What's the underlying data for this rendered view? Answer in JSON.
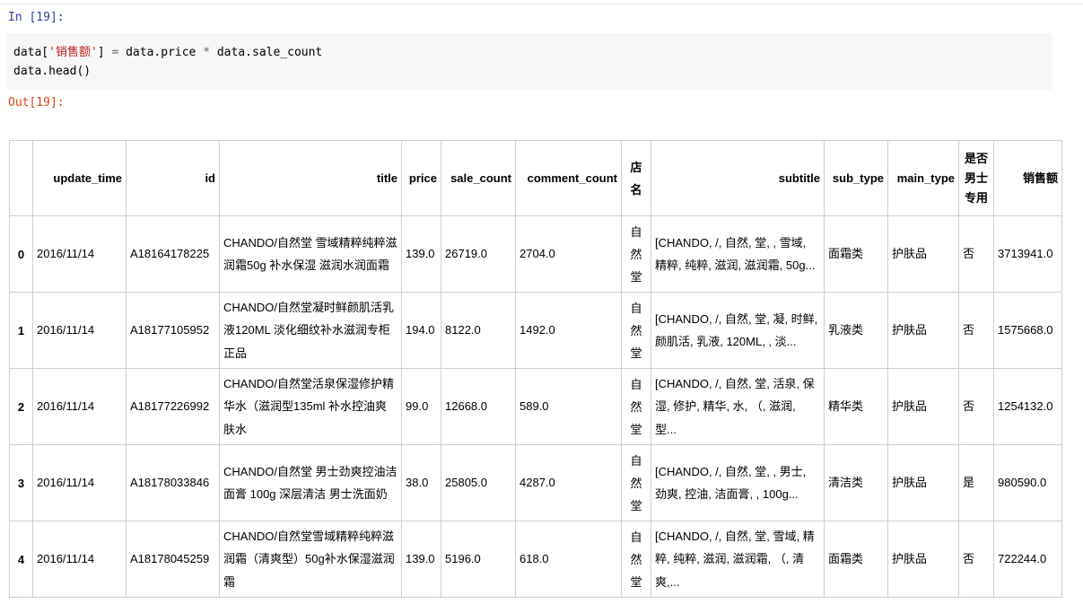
{
  "cell": {
    "in_prompt": "In [19]:",
    "code_line1": {
      "a": "data[",
      "b": "'销售额'",
      "c": "] ",
      "d": "=",
      "e": " data.price ",
      "f": "*",
      "g": " data.sale_count"
    },
    "code_line2": "data.head()",
    "out_prompt": "Out[19]:"
  },
  "table": {
    "columns": [
      "",
      "update_time",
      "id",
      "title",
      "price",
      "sale_count",
      "comment_count",
      "店名",
      "subtitle",
      "sub_type",
      "main_type",
      "是否男士专用",
      "销售额"
    ],
    "rows": [
      [
        "0",
        "2016/11/14",
        "A18164178225",
        "CHANDO/自然堂 雪域精粹纯粹滋润霜50g 补水保湿 滋润水润面霜",
        "139.0",
        "26719.0",
        "2704.0",
        "自然堂",
        "[CHANDO, /, 自然, 堂, , 雪域, 精粹, 纯粹, 滋润, 滋润霜, 50g...",
        "面霜类",
        "护肤品",
        "否",
        "3713941.0"
      ],
      [
        "1",
        "2016/11/14",
        "A18177105952",
        "CHANDO/自然堂凝时鲜颜肌活乳液120ML 淡化细纹补水滋润专柜正品",
        "194.0",
        "8122.0",
        "1492.0",
        "自然堂",
        "[CHANDO, /, 自然, 堂, 凝, 时鲜, 颜肌活, 乳液, 120ML, , 淡...",
        "乳液类",
        "护肤品",
        "否",
        "1575668.0"
      ],
      [
        "2",
        "2016/11/14",
        "A18177226992",
        "CHANDO/自然堂活泉保湿修护精华水（滋润型135ml 补水控油爽肤水",
        "99.0",
        "12668.0",
        "589.0",
        "自然堂",
        "[CHANDO, /, 自然, 堂, 活泉, 保湿, 修护, 精华, 水, （, 滋润, 型...",
        "精华类",
        "护肤品",
        "否",
        "1254132.0"
      ],
      [
        "3",
        "2016/11/14",
        "A18178033846",
        "CHANDO/自然堂 男士劲爽控油洁面膏 100g 深层清洁 男士洗面奶",
        "38.0",
        "25805.0",
        "4287.0",
        "自然堂",
        "[CHANDO, /, 自然, 堂, , 男士, 劲爽, 控油, 洁面膏, , 100g...",
        "清洁类",
        "护肤品",
        "是",
        "980590.0"
      ],
      [
        "4",
        "2016/11/14",
        "A18178045259",
        "CHANDO/自然堂雪域精粹纯粹滋润霜（清爽型）50g补水保湿滋润霜",
        "139.0",
        "5196.0",
        "618.0",
        "自然堂",
        "[CHANDO, /, 自然, 堂, 雪域, 精粹, 纯粹, 滋润, 滋润霜, （, 清爽,...",
        "面霜类",
        "护肤品",
        "否",
        "722244.0"
      ]
    ]
  }
}
